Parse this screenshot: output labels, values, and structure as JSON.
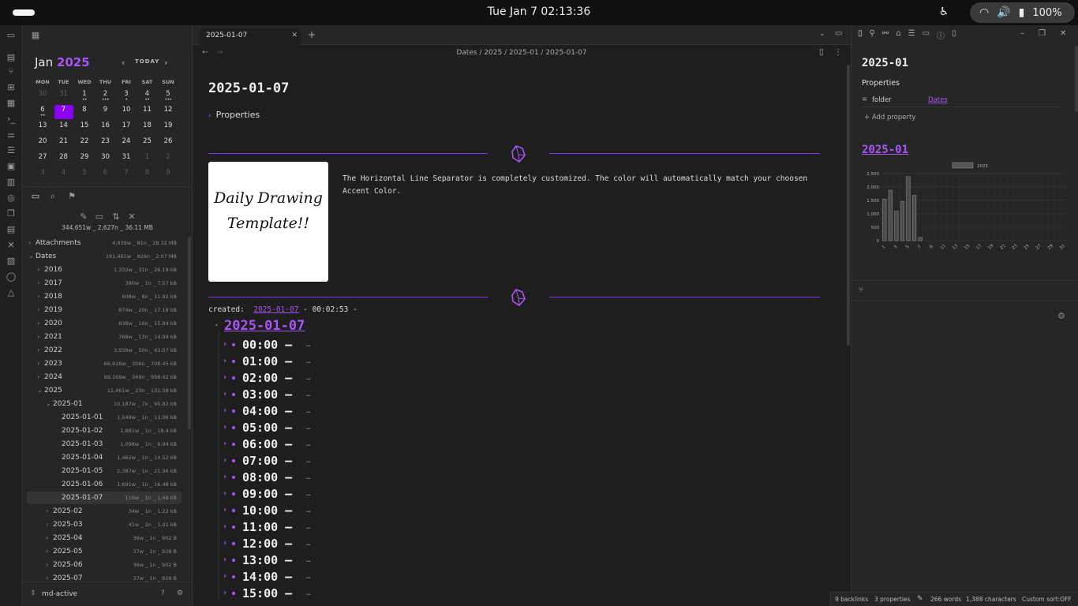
{
  "topbar": {
    "clock": "Tue Jan 7  02:13:36",
    "battery": "100%"
  },
  "calendar": {
    "month": "Jan",
    "year": "2025",
    "today_label": "TODAY",
    "dows": [
      "MON",
      "TUE",
      "WED",
      "THU",
      "FRI",
      "SAT",
      "SUN"
    ],
    "weeks": [
      [
        {
          "d": "30",
          "dim": true
        },
        {
          "d": "31",
          "dim": true
        },
        {
          "d": "1",
          "dots": "••"
        },
        {
          "d": "2",
          "dots": "•••"
        },
        {
          "d": "3",
          "dots": "•"
        },
        {
          "d": "4",
          "dots": "••"
        },
        {
          "d": "5",
          "dots": "•••"
        }
      ],
      [
        {
          "d": "6",
          "dots": "••"
        },
        {
          "d": "7",
          "sel": true
        },
        {
          "d": "8"
        },
        {
          "d": "9"
        },
        {
          "d": "10"
        },
        {
          "d": "11"
        },
        {
          "d": "12"
        }
      ],
      [
        {
          "d": "13"
        },
        {
          "d": "14"
        },
        {
          "d": "15"
        },
        {
          "d": "16"
        },
        {
          "d": "17"
        },
        {
          "d": "18"
        },
        {
          "d": "19"
        }
      ],
      [
        {
          "d": "20"
        },
        {
          "d": "21"
        },
        {
          "d": "22"
        },
        {
          "d": "23"
        },
        {
          "d": "24"
        },
        {
          "d": "25"
        },
        {
          "d": "26"
        }
      ],
      [
        {
          "d": "27"
        },
        {
          "d": "28"
        },
        {
          "d": "29"
        },
        {
          "d": "30"
        },
        {
          "d": "31"
        },
        {
          "d": "1",
          "dim": true
        },
        {
          "d": "2",
          "dim": true
        }
      ],
      [
        {
          "d": "3",
          "dim": true
        },
        {
          "d": "4",
          "dim": true
        },
        {
          "d": "5",
          "dim": true
        },
        {
          "d": "6",
          "dim": true
        },
        {
          "d": "7",
          "dim": true
        },
        {
          "d": "8",
          "dim": true
        },
        {
          "d": "9",
          "dim": true
        }
      ]
    ]
  },
  "vault_stats": "344,651w _ 2,627n _ 36.11 MB",
  "tree": [
    {
      "label": "Attachments",
      "meta": "4,939w _ 81n _ 28.32 MB",
      "level": 0,
      "open": false
    },
    {
      "label": "Dates",
      "meta": "191,461w _ 826n _ 2.07 MB",
      "level": 0,
      "open": true
    },
    {
      "label": "2016",
      "meta": "1,332w _ 31n _ 26.19 kB",
      "level": 1,
      "open": false
    },
    {
      "label": "2017",
      "meta": "380w _ 1n _ 7.57 kB",
      "level": 1,
      "open": false
    },
    {
      "label": "2018",
      "meta": "608w _ 8n _ 11.92 kB",
      "level": 1,
      "open": false
    },
    {
      "label": "2019",
      "meta": "874w _ 20n _ 17.18 kB",
      "level": 1,
      "open": false
    },
    {
      "label": "2020",
      "meta": "838w _ 16n _ 15.84 kB",
      "level": 1,
      "open": false
    },
    {
      "label": "2021",
      "meta": "768w _ 13n _ 14.99 kB",
      "level": 1,
      "open": false
    },
    {
      "label": "2022",
      "meta": "3,939w _ 50n _ 43.07 kB",
      "level": 1,
      "open": false
    },
    {
      "label": "2023",
      "meta": "66,916w _ 306n _ 708.45 kB",
      "level": 1,
      "open": false
    },
    {
      "label": "2024",
      "meta": "99,169w _ 349n _ 998.42 kB",
      "level": 1,
      "open": false
    },
    {
      "label": "2025",
      "meta": "11,461w _ 23n _ 131.58 kB",
      "level": 1,
      "open": true
    },
    {
      "label": "2025-01",
      "meta": "10,187w _ 7n _ 95.82 kB",
      "level": 2,
      "open": true
    },
    {
      "label": "2025-01-01",
      "meta": "1,549w _ 1n _ 13.06 kB",
      "level": 3,
      "file": true
    },
    {
      "label": "2025-01-02",
      "meta": "1,881w _ 1n _ 18.4 kB",
      "level": 3,
      "file": true
    },
    {
      "label": "2025-01-03",
      "meta": "1,098w _ 1n _ 9.94 kB",
      "level": 3,
      "file": true
    },
    {
      "label": "2025-01-04",
      "meta": "1,462w _ 1n _ 14.52 kB",
      "level": 3,
      "file": true
    },
    {
      "label": "2025-01-05",
      "meta": "2,387w _ 1n _ 21.96 kB",
      "level": 3,
      "file": true
    },
    {
      "label": "2025-01-06",
      "meta": "1,691w _ 1n _ 16.48 kB",
      "level": 3,
      "file": true
    },
    {
      "label": "2025-01-07",
      "meta": "119w _ 1n _ 1.46 kB",
      "level": 3,
      "file": true,
      "active": true
    },
    {
      "label": "2025-02",
      "meta": "34w _ 1n _ 1.22 kB",
      "level": 2,
      "open": false
    },
    {
      "label": "2025-03",
      "meta": "41w _ 2n _ 1.41 kB",
      "level": 2,
      "open": false
    },
    {
      "label": "2025-04",
      "meta": "36w _ 1n _ 902 B",
      "level": 2,
      "open": false
    },
    {
      "label": "2025-05",
      "meta": "37w _ 1n _ 928 B",
      "level": 2,
      "open": false
    },
    {
      "label": "2025-06",
      "meta": "36w _ 1n _ 902 B",
      "level": 2,
      "open": false
    },
    {
      "label": "2025-07",
      "meta": "37w _ 1n _ 928 B",
      "level": 2,
      "open": false
    }
  ],
  "vault_name": "md-active",
  "tab": {
    "label": "2025-01-07"
  },
  "breadcrumb": "Dates / 2025 / 2025-01 / 2025-01-07",
  "note": {
    "title": "2025-01-07",
    "properties_label": "Properties",
    "drawing_text_1": "Daily Drawing",
    "drawing_text_2": "Template!!",
    "callout": "The Horizontal Line Separator is completely customized. The color will automatically match your choosen Accent Color.",
    "created_label": "created:",
    "created_link": "2025-01-07",
    "created_time": " - 00:02:53 -",
    "day_heading": "2025-01-07",
    "hours": [
      "00:00",
      "01:00",
      "02:00",
      "03:00",
      "04:00",
      "05:00",
      "06:00",
      "07:00",
      "08:00",
      "09:00",
      "10:00",
      "11:00",
      "12:00",
      "13:00",
      "14:00",
      "15:00"
    ],
    "hour_suffix": " –",
    "ellipsis": "…"
  },
  "right": {
    "title": "2025-01",
    "properties_label": "Properties",
    "prop_key": "folder",
    "prop_value": "Dates",
    "add_property": "+ Add property",
    "link_title": "2025-01",
    "legend": "2025"
  },
  "chart_data": {
    "type": "bar",
    "title": "",
    "series": [
      {
        "name": "2025",
        "values": [
          1549,
          1881,
          1098,
          1462,
          2387,
          1691,
          119,
          0,
          0,
          0,
          0,
          0,
          0,
          0,
          0,
          0,
          0,
          0,
          0,
          0,
          0,
          0,
          0,
          0,
          0,
          0,
          0,
          0,
          0,
          0,
          0
        ]
      }
    ],
    "categories": [
      "1",
      "2",
      "3",
      "4",
      "5",
      "6",
      "7",
      "8",
      "9",
      "10",
      "11",
      "12",
      "13",
      "14",
      "15",
      "16",
      "17",
      "18",
      "19",
      "20",
      "21",
      "22",
      "23",
      "24",
      "25",
      "26",
      "27",
      "28",
      "29",
      "30",
      "31"
    ],
    "tick_labels_x": [
      "1",
      "3",
      "5",
      "7",
      "9",
      "11",
      "13",
      "15",
      "17",
      "19",
      "21",
      "23",
      "25",
      "27",
      "29",
      "31"
    ],
    "tick_labels_y": [
      "0",
      "500",
      "1,000",
      "1,500",
      "2,000",
      "2,500"
    ],
    "ylim": [
      0,
      2500
    ],
    "grid": true,
    "legend_position": "top"
  },
  "statusbar": {
    "backlinks": "9 backlinks",
    "properties": "3 properties",
    "words": "266 words",
    "chars": "1,388 characters",
    "sort": "Custom sort:OFF"
  },
  "colors": {
    "accent": "#a855f7",
    "selected_day": "#8a00f2"
  }
}
